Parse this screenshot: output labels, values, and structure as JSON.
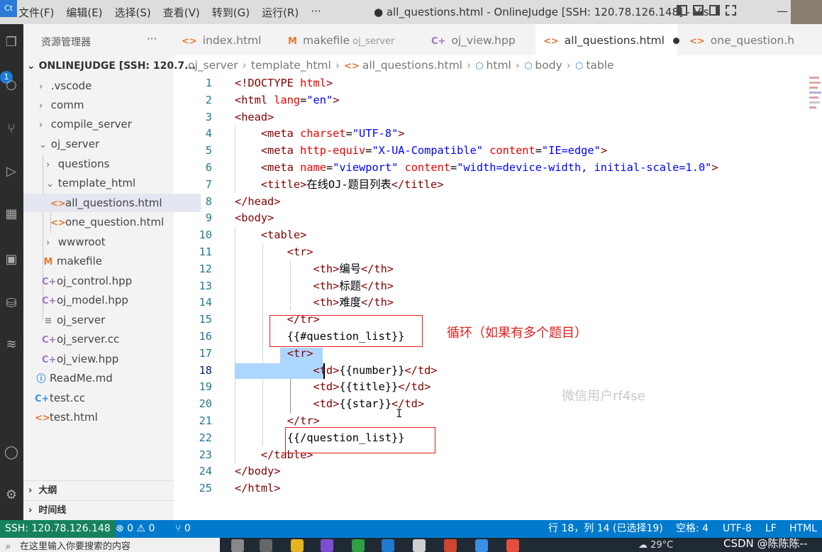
{
  "titlebar": {
    "app_icon": "Ct",
    "menu": [
      "文件(F)",
      "编辑(E)",
      "选择(S)",
      "查看(V)",
      "转到(G)",
      "运行(R)",
      "···"
    ],
    "window_title": "● all_questions.html - OnlineJudge [SSH: 120.78.126.148] - Vis...",
    "minimize": "—"
  },
  "activity": {
    "badge": "1"
  },
  "sidebar": {
    "title": "资源管理器",
    "more": "···",
    "root": "ONLINEJUDGE [SSH: 120.7...",
    "items": [
      {
        "label": ".vscode",
        "chev": "›",
        "icon": ""
      },
      {
        "label": "comm",
        "chev": "›",
        "icon": ""
      },
      {
        "label": "compile_server",
        "chev": "›",
        "icon": ""
      },
      {
        "label": "oj_server",
        "chev": "⌄",
        "icon": ""
      },
      {
        "label": "questions",
        "chev": "›",
        "icon": ""
      },
      {
        "label": "template_html",
        "chev": "⌄",
        "icon": ""
      },
      {
        "label": "all_questions.html",
        "chev": "",
        "icon": "<>"
      },
      {
        "label": "one_question.html",
        "chev": "",
        "icon": "<>"
      },
      {
        "label": "wwwroot",
        "chev": "›",
        "icon": ""
      },
      {
        "label": "makefile",
        "chev": "",
        "icon": "M"
      },
      {
        "label": "oj_control.hpp",
        "chev": "",
        "icon": "C+"
      },
      {
        "label": "oj_model.hpp",
        "chev": "",
        "icon": "C+"
      },
      {
        "label": "oj_server",
        "chev": "",
        "icon": "≡"
      },
      {
        "label": "oj_server.cc",
        "chev": "",
        "icon": "C+"
      },
      {
        "label": "oj_view.hpp",
        "chev": "",
        "icon": "C+"
      },
      {
        "label": "ReadMe.md",
        "chev": "",
        "icon": "ⓘ"
      },
      {
        "label": "test.cc",
        "chev": "",
        "icon": "C+"
      },
      {
        "label": "test.html",
        "chev": "",
        "icon": "<>"
      }
    ],
    "outline": "大纲",
    "timeline": "时间线"
  },
  "tabs": [
    {
      "icon": "<>",
      "label": "index.html",
      "sub": "",
      "active": false
    },
    {
      "icon": "M",
      "label": "makefile",
      "sub": "oj_server",
      "active": false
    },
    {
      "icon": "C+",
      "label": "oj_view.hpp",
      "sub": "",
      "active": false
    },
    {
      "icon": "<>",
      "label": "all_questions.html",
      "sub": "",
      "active": true
    },
    {
      "icon": "<>",
      "label": "one_question.h",
      "sub": "",
      "active": false
    }
  ],
  "breadcrumb": [
    "oj_server",
    "template_html",
    "all_questions.html",
    "html",
    "body",
    "table"
  ],
  "editor": {
    "line_numbers": [
      "1",
      "2",
      "3",
      "4",
      "5",
      "6",
      "7",
      "8",
      "9",
      "10",
      "11",
      "12",
      "13",
      "14",
      "15",
      "16",
      "17",
      "18",
      "19",
      "20",
      "21",
      "22",
      "23",
      "24",
      "25"
    ],
    "current_line": "18",
    "annotation": "循环（如果有多个题目）",
    "watermark": "微信用户rf4se",
    "ibeam": "I"
  },
  "statusbar": {
    "remote": "SSH: 120.78.126.148",
    "problems": "⊗ 0 ⚠ 0",
    "ports": "⑂ 0",
    "position": "行 18，列 14 (已选择19)",
    "spaces": "空格: 4",
    "encoding": "UTF-8",
    "eol": "LF",
    "language": "HTML"
  },
  "taskbar": {
    "search_placeholder": "在这里输入你要搜索的内容",
    "weather": "29°C",
    "csdn": "CSDN @陈陈陈--"
  }
}
